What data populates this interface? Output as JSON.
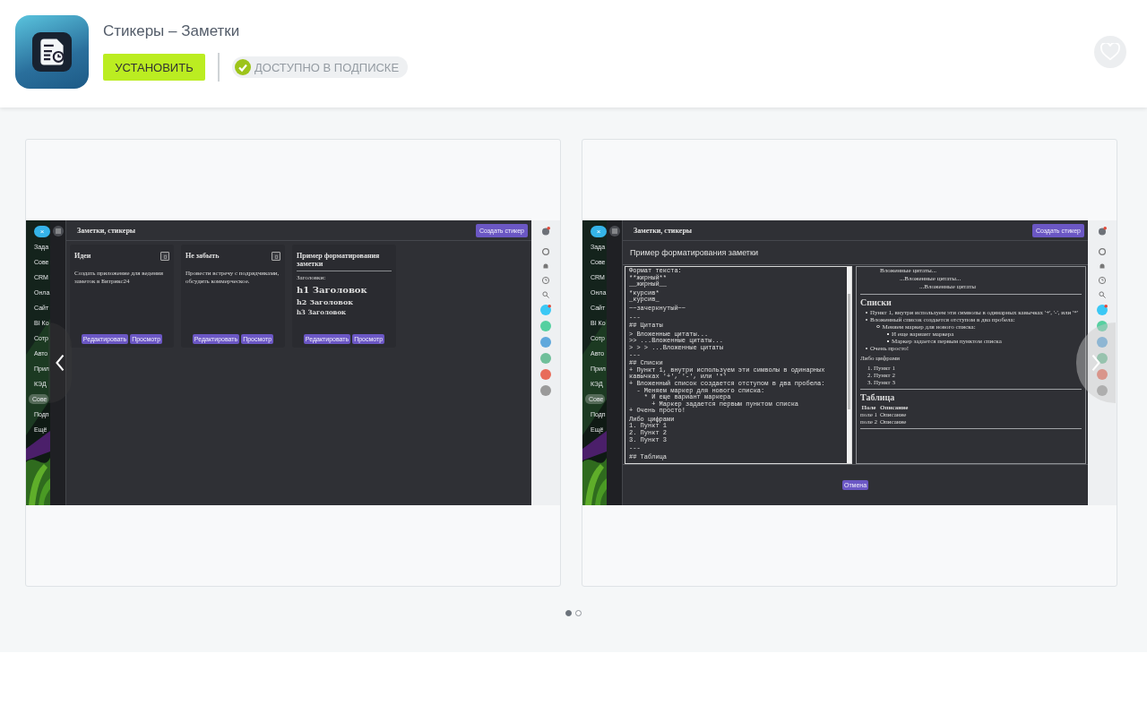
{
  "app": {
    "title": "Стикеры – Заметки",
    "install_button": "УСТАНОВИТЬ",
    "subscription_badge": "ДОСТУПНО В ПОДПИСКЕ"
  },
  "slides": [
    {
      "kind": "board",
      "close_label": "×",
      "sidebar_items": [
        {
          "text": "Зада",
          "selected": false
        },
        {
          "text": "Сове",
          "selected": false
        },
        {
          "text": "CRM",
          "selected": false
        },
        {
          "text": "Онла",
          "selected": false
        },
        {
          "text": "Сайт",
          "selected": false
        },
        {
          "text": "BI Ко",
          "selected": false
        },
        {
          "text": "Сотр",
          "selected": false
        },
        {
          "text": "Авто",
          "selected": false
        },
        {
          "text": "Прил",
          "selected": false
        },
        {
          "text": "КЭД",
          "selected": false
        },
        {
          "text": "Сове",
          "selected": true
        },
        {
          "text": "Подп",
          "selected": false
        },
        {
          "text": "Ещё",
          "selected": false
        }
      ],
      "app_title": "Заметки, стикеры",
      "create_button": "Создать стикер",
      "notes": [
        {
          "kind": "plain",
          "title": "Идеи",
          "text": "Создать приложение для ведения заметок в Битрикс24",
          "edit_button": "Редактировать",
          "view_button": "Просмотр"
        },
        {
          "kind": "plain",
          "title": "Не забыть",
          "text": "Провести встречу с подрядчиками, обсудить коммерческое.",
          "edit_button": "Редактировать",
          "view_button": "Просмотр"
        },
        {
          "kind": "formatted",
          "title": "Пример форматирования заметки",
          "blocks": [
            {
              "kind": "p",
              "text": "Заголовки:"
            },
            {
              "kind": "h1",
              "text": "h1 Заголовок"
            },
            {
              "kind": "h2",
              "text": "h2 Заголовок"
            },
            {
              "kind": "h3",
              "text": "h3 Заголовок"
            }
          ],
          "edit_button": "Редактировать",
          "view_button": "Просмотр"
        }
      ]
    },
    {
      "kind": "editor",
      "close_label": "×",
      "sidebar_items": [
        {
          "text": "Зада",
          "selected": false
        },
        {
          "text": "Сове",
          "selected": false
        },
        {
          "text": "CRM",
          "selected": false
        },
        {
          "text": "Онла",
          "selected": false
        },
        {
          "text": "Сайт",
          "selected": false
        },
        {
          "text": "BI Ко",
          "selected": false
        },
        {
          "text": "Сотр",
          "selected": false
        },
        {
          "text": "Авто",
          "selected": false
        },
        {
          "text": "Прил",
          "selected": false
        },
        {
          "text": "КЭД",
          "selected": false
        },
        {
          "text": "Сове",
          "selected": true
        },
        {
          "text": "Подп",
          "selected": false
        },
        {
          "text": "Ещё",
          "selected": false
        }
      ],
      "app_title": "Заметки, стикеры",
      "create_button": "Создать стикер",
      "dialog_title": "Пример форматирования заметки",
      "cancel_button": "Отмена",
      "editor_lines": [
        {
          "kind": "code",
          "text": "Формат текста:"
        },
        {
          "kind": "code",
          "text": "**жирный**"
        },
        {
          "kind": "code",
          "text": "__жирный__"
        },
        {
          "kind": "blank"
        },
        {
          "kind": "code",
          "text": "*курсив*"
        },
        {
          "kind": "code",
          "text": "_курсив_"
        },
        {
          "kind": "blank"
        },
        {
          "kind": "code",
          "text": "~~зачеркнутый~~"
        },
        {
          "kind": "blank"
        },
        {
          "kind": "code",
          "text": "---"
        },
        {
          "kind": "blank"
        },
        {
          "kind": "code",
          "text": "## Цитаты"
        },
        {
          "kind": "blank"
        },
        {
          "kind": "code",
          "text": "> Вложенные цитаты..."
        },
        {
          "kind": "code",
          "text": ">> ...Вложенные цитаты..."
        },
        {
          "kind": "code",
          "text": "> > > ...Вложенные цитаты"
        },
        {
          "kind": "code",
          "text": "---"
        },
        {
          "kind": "blank"
        },
        {
          "kind": "code",
          "text": "## Списки"
        },
        {
          "kind": "code",
          "text": "+ Пункт 1, внутри используем эти символы в одинарных кавычках '+', '-', или '*'"
        },
        {
          "kind": "code",
          "text": "+ Вложенный список создается отступом в два пробела:"
        },
        {
          "kind": "code",
          "text": "  - Меняем маркер для нового списка:"
        },
        {
          "kind": "code",
          "text": "    * И еще вариант маркера"
        },
        {
          "kind": "code",
          "text": "      + Маркер задается первым пунктом списка"
        },
        {
          "kind": "code",
          "text": "+ Очень просто!"
        },
        {
          "kind": "blank"
        },
        {
          "kind": "code",
          "text": "Либо цифрами"
        },
        {
          "kind": "code",
          "text": "1. Пункт 1"
        },
        {
          "kind": "code",
          "text": "2. Пункт 2"
        },
        {
          "kind": "code",
          "text": "3. Пункт 3"
        },
        {
          "kind": "blank"
        },
        {
          "kind": "code",
          "text": "---"
        },
        {
          "kind": "blank"
        },
        {
          "kind": "code",
          "text": "## Таблица"
        }
      ],
      "preview": [
        {
          "kind": "quote",
          "text": "Вложенные цитаты...",
          "children": [
            {
              "kind": "quote",
              "text": "...Вложенные цитаты...",
              "children": [
                {
                  "kind": "quote",
                  "text": "...Вложенные цитаты"
                }
              ]
            }
          ]
        },
        {
          "kind": "rule"
        },
        {
          "kind": "heading",
          "text": "Списки"
        },
        {
          "kind": "bullets",
          "items": [
            {
              "text": "Пункт 1, внутри используем эти символы в одинарных кавычках '+', '-', или '*'"
            },
            {
              "text": "Вложенный список создается отступом в два пробела:",
              "children": [
                {
                  "text": "Меняем маркер для нового списка:",
                  "children": [
                    {
                      "text": "И еще вариант маркера"
                    },
                    {
                      "text": "Маркер задается первым пунктом списка"
                    }
                  ]
                }
              ]
            },
            {
              "text": "Очень просто!"
            }
          ]
        },
        {
          "kind": "paragraph",
          "text": "Либо цифрами"
        },
        {
          "kind": "numbers",
          "items": [
            {
              "text": "1. Пункт 1"
            },
            {
              "text": "2. Пункт 2"
            },
            {
              "text": "3. Пункт 3"
            }
          ]
        },
        {
          "kind": "rule"
        },
        {
          "kind": "heading",
          "text": "Таблица"
        },
        {
          "kind": "table",
          "columns": [
            "Поле",
            "Описание"
          ],
          "rows": [
            [
              "поле 1",
              "Описание"
            ],
            [
              "поле 2",
              "Описание"
            ]
          ]
        },
        {
          "kind": "rule"
        }
      ]
    }
  ],
  "carousel": {
    "dots": [
      {
        "selected": true
      },
      {
        "selected": false
      }
    ]
  }
}
